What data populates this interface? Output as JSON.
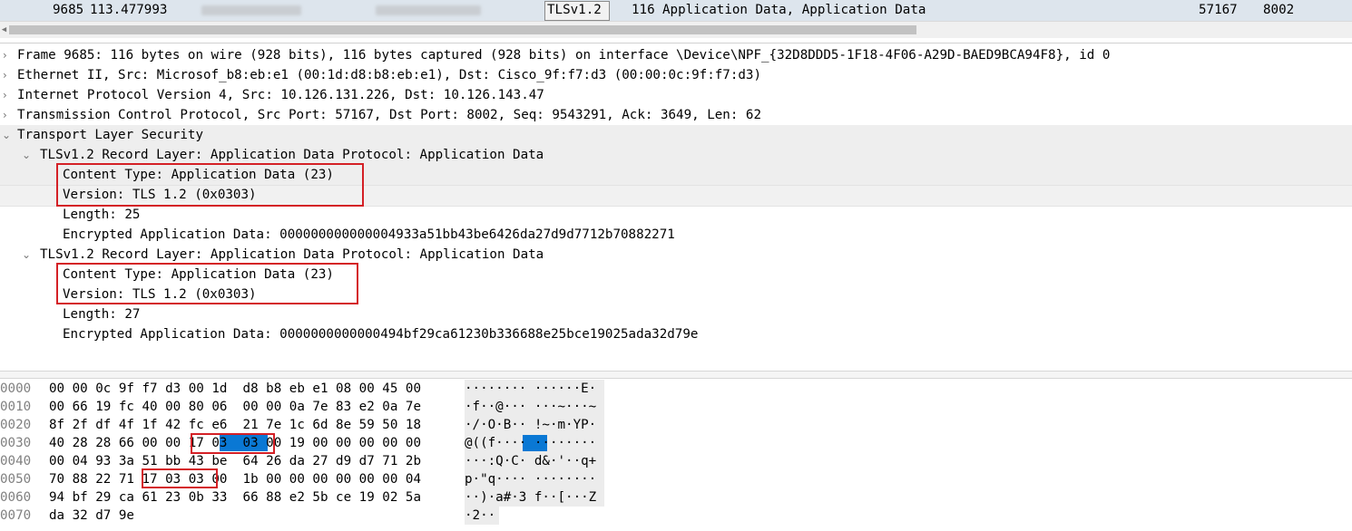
{
  "packet_list": {
    "no": "9685",
    "time": "113.477993",
    "protocol": "TLSv1.2",
    "length": "116",
    "info": "Application Data, Application Data",
    "src_port": "57167",
    "dst_port": "8002"
  },
  "detail_tree": [
    {
      "text": "Frame 9685: 116 bytes on wire (928 bits), 116 bytes captured (928 bits) on interface \\Device\\NPF_{32D8DDD5-1F18-4F06-A29D-BAED9BCA94F8}, id 0",
      "expanded": false
    },
    {
      "text": "Ethernet II, Src: Microsof_b8:eb:e1 (00:1d:d8:b8:eb:e1), Dst: Cisco_9f:f7:d3 (00:00:0c:9f:f7:d3)",
      "expanded": false
    },
    {
      "text": "Internet Protocol Version 4, Src: 10.126.131.226, Dst: 10.126.143.47",
      "expanded": false
    },
    {
      "text": "Transmission Control Protocol, Src Port: 57167, Dst Port: 8002, Seq: 9543291, Ack: 3649, Len: 62",
      "expanded": false
    },
    {
      "text": "Transport Layer Security",
      "expanded": true
    },
    {
      "text": "TLSv1.2 Record Layer: Application Data Protocol: Application Data",
      "expanded": true
    },
    {
      "text": "Content Type: Application Data (23)"
    },
    {
      "text": "Version: TLS 1.2 (0x0303)"
    },
    {
      "text": "Length: 25"
    },
    {
      "text": "Encrypted Application Data: 000000000000004933a51bb43be6426da27d9d7712b70882271"
    },
    {
      "text": "TLSv1.2 Record Layer: Application Data Protocol: Application Data",
      "expanded": true
    },
    {
      "text": "Content Type: Application Data (23)"
    },
    {
      "text": "Version: TLS 1.2 (0x0303)"
    },
    {
      "text": "Length: 27"
    },
    {
      "text": "Encrypted Application Data: 0000000000000494bf29ca61230b336688e25bce19025ada32d79e"
    }
  ],
  "hex_dump": [
    {
      "offset": "0000",
      "bytes": "00 00 0c 9f f7 d3 00 1d  d8 b8 eb e1 08 00 45 00",
      "ascii": "········ ······E·"
    },
    {
      "offset": "0010",
      "bytes": "00 66 19 fc 40 00 80 06  00 00 0a 7e 83 e2 0a 7e",
      "ascii": "·f··@··· ···~···~"
    },
    {
      "offset": "0020",
      "bytes": "8f 2f df 4f 1f 42 fc e6  21 7e 1c 6d 8e 59 50 18",
      "ascii": "·/·O·B·· !~·m·YP·"
    },
    {
      "offset": "0030",
      "bytes": "40 28 28 66 00 00 17 03  03 00 19 00 00 00 00 00",
      "ascii": "@((f···· ········"
    },
    {
      "offset": "0040",
      "bytes": "00 04 93 3a 51 bb 43 be  64 26 da 27 d9 d7 71 2b",
      "ascii": "···:Q·C· d&·'··q+"
    },
    {
      "offset": "0050",
      "bytes": "70 88 22 71 17 03 03 00  1b 00 00 00 00 00 00 04",
      "ascii": "p·\"q···· ········"
    },
    {
      "offset": "0060",
      "bytes": "94 bf 29 ca 61 23 0b 33  66 88 e2 5b ce 19 02 5a",
      "ascii": "··)·a#·3 f··[···Z"
    },
    {
      "offset": "0070",
      "bytes": "da 32 d7 9e",
      "ascii": "·2··"
    }
  ],
  "colors": {
    "selected_packet_row": "#dde5ed",
    "hex_highlight": "#0a78d4",
    "annotation_box": "#d42026"
  }
}
